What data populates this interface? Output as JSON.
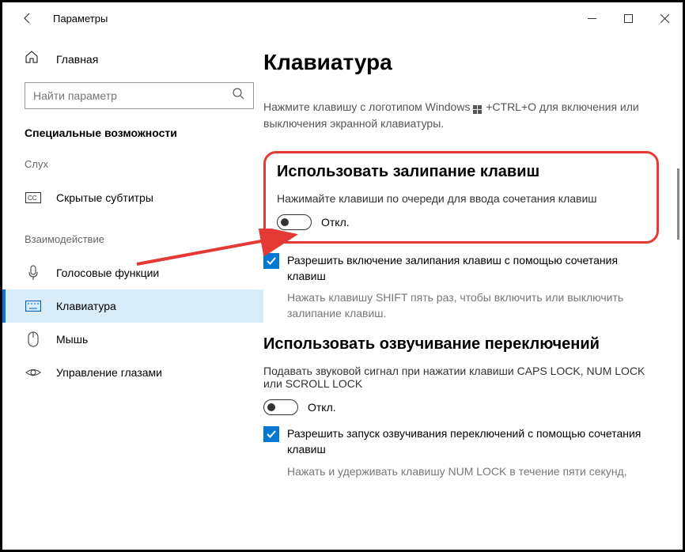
{
  "window": {
    "title": "Параметры"
  },
  "sidebar": {
    "home": "Главная",
    "search_placeholder": "Найти параметр",
    "section": "Специальные возможности",
    "groups": [
      {
        "label": "Слух",
        "items": [
          {
            "key": "captions",
            "label": "Скрытые субтитры"
          }
        ]
      },
      {
        "label": "Взаимодействие",
        "items": [
          {
            "key": "speech",
            "label": "Голосовые функции"
          },
          {
            "key": "keyboard",
            "label": "Клавиатура",
            "active": true
          },
          {
            "key": "mouse",
            "label": "Мышь"
          },
          {
            "key": "eye",
            "label": "Управление глазами"
          }
        ]
      }
    ]
  },
  "main": {
    "title": "Клавиатура",
    "osk_hint_1": "Нажмите клавишу с логотипом Windows",
    "osk_hint_2": "+CTRL+O для включения или выключения экранной клавиатуры.",
    "sticky": {
      "heading": "Использовать залипание клавиш",
      "desc": "Нажимайте клавиши по очереди для ввода сочетания клавиш",
      "toggle_state": "Откл.",
      "check_label": "Разрешить включение залипания клавиш с помощью сочетания клавиш",
      "check_hint": "Нажать клавишу SHIFT пять раз, чтобы включить или выключить залипание клавиш."
    },
    "toggle_keys": {
      "heading": "Использовать озвучивание переключений",
      "desc": "Подавать звуковой сигнал при нажатии клавиши CAPS LOCK, NUM LOCK или SCROLL LOCK",
      "toggle_state": "Откл.",
      "check_label": "Разрешить запуск озвучивания переключений с помощью сочетания клавиш",
      "check_hint": "Нажать и удерживать клавишу NUM LOCK в течение пяти секунд,"
    }
  }
}
